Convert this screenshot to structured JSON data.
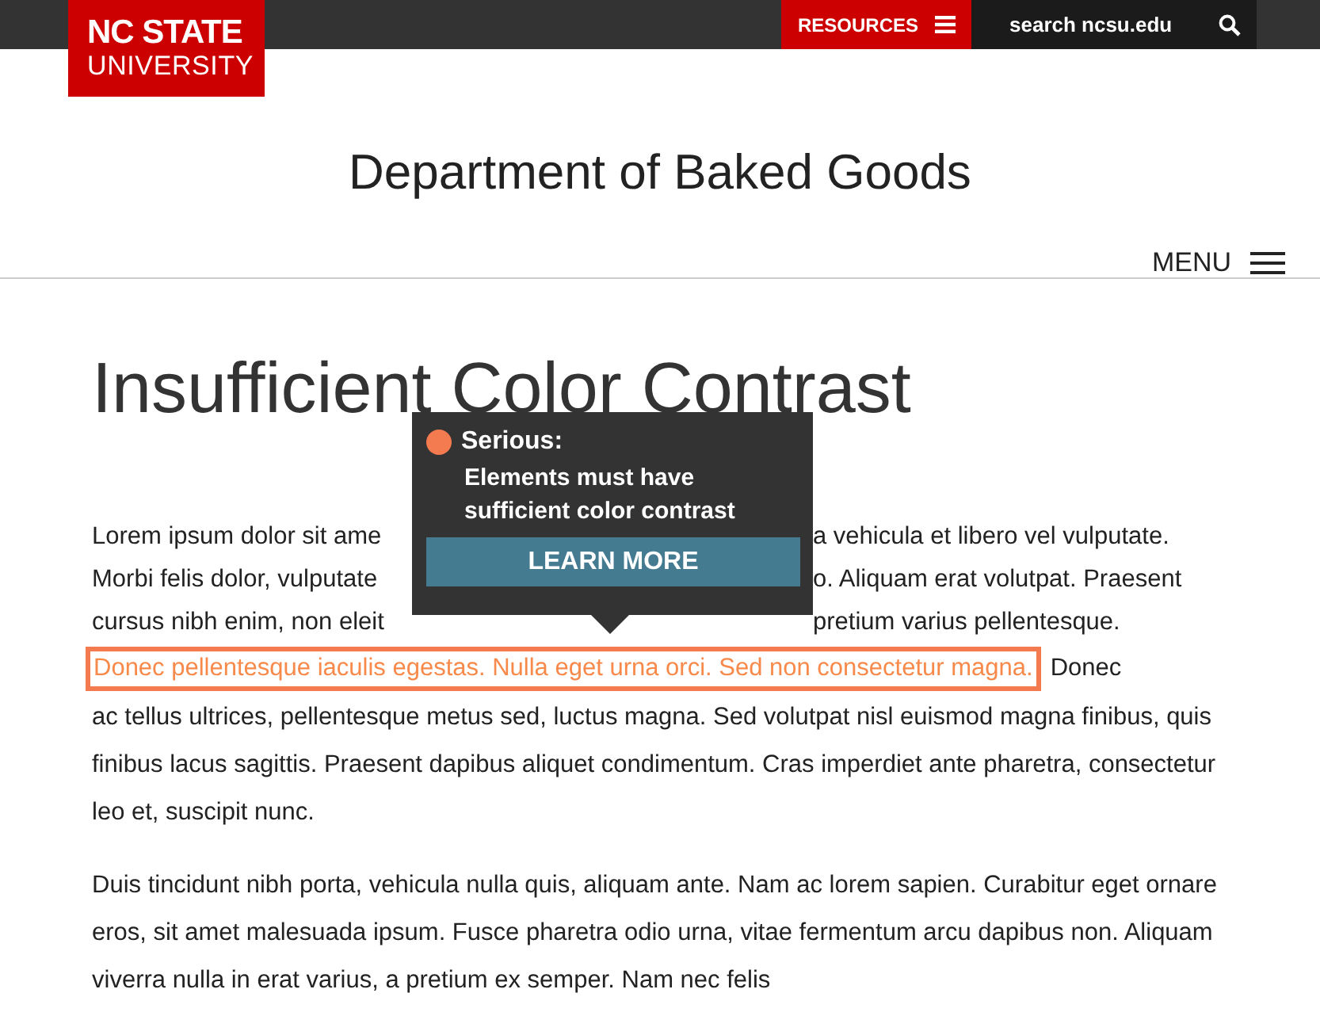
{
  "header": {
    "logo": {
      "line_1": "NC STATE",
      "line_2": "UNIVERSITY"
    },
    "resources_button": "RESOURCES",
    "search": {
      "placeholder": "search ncsu.edu"
    }
  },
  "site_title": "Department of Baked Goods",
  "menu_button": "MENU",
  "page_heading": "Insufficient Color Contrast",
  "tooltip": {
    "severity": "Serious:",
    "message": "Elements must have sufficient color contrast",
    "button": "LEARN MORE"
  },
  "paragraphs": [
    {
      "obscured_lines": [
        {
          "left": "Lorem ipsum dolor sit ame",
          "right": "a vehicula et libero vel vulputate."
        },
        {
          "left": "Morbi felis dolor, vulputate",
          "right": "o. Aliquam erat volutpat. Praesent"
        },
        {
          "left": "cursus nibh enim, non eleit",
          "right": "pretium varius pellentesque."
        }
      ],
      "highlighted": "Donec pellentesque iaculis egestas. Nulla eget urna orci. Sed non consectetur magna.",
      "after_highlight": "Donec",
      "text": "ac tellus ultrices, pellentesque metus sed, luctus magna. Sed volutpat nisl euismod magna finibus, quis finibus lacus sagittis. Praesent dapibus aliquet condimentum. Cras imperdiet ante pharetra, consectetur leo et, suscipit nunc."
    },
    {
      "text": "Duis tincidunt nibh porta, vehicula nulla quis, aliquam ante. Nam ac lorem sapien. Curabitur eget ornare eros, sit amet malesuada ipsum. Fusce pharetra odio urna, vitae fermentum arcu dapibus non. Aliquam viverra nulla in erat varius, a pretium ex semper. Nam nec felis"
    }
  ]
}
